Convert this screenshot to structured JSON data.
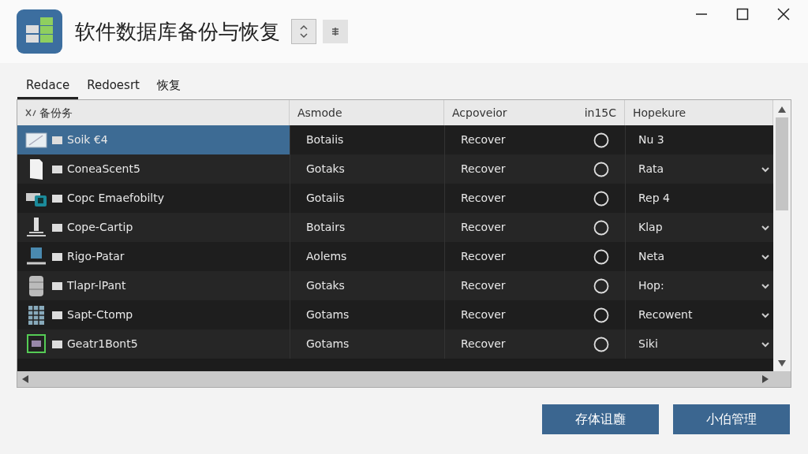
{
  "window": {
    "title": "软件数据库备份与恢复"
  },
  "tabs": [
    {
      "label": "Redace",
      "selected": true
    },
    {
      "label": "Redoesrt",
      "selected": false
    },
    {
      "label": "恢复",
      "selected": false
    }
  ],
  "table": {
    "columns": [
      {
        "label": "备份务"
      },
      {
        "label": "Asmode"
      },
      {
        "label": "Acpoveior",
        "extra": "in15C"
      },
      {
        "label": "Hopekure"
      }
    ],
    "rows": [
      {
        "kind": "image",
        "name": "Soik €4",
        "mode": "Botaiis",
        "action": "Recover",
        "value": "Nu 3",
        "dropdown": false,
        "selected": true
      },
      {
        "kind": "document",
        "name": "ConeaScent5",
        "mode": "Gotaks",
        "action": "Recover",
        "value": "Rata",
        "dropdown": true,
        "selected": false
      },
      {
        "kind": "drive",
        "name": "Copc Emaefobilty",
        "mode": "Gotaiis",
        "action": "Recover",
        "value": "Rep 4",
        "dropdown": false,
        "selected": false
      },
      {
        "kind": "network",
        "name": "Cope-Cartip",
        "mode": "Botairs",
        "action": "Recover",
        "value": "Klap",
        "dropdown": true,
        "selected": false
      },
      {
        "kind": "monitor",
        "name": "Rigo-Patar",
        "mode": "Aolems",
        "action": "Recover",
        "value": "Neta",
        "dropdown": true,
        "selected": false
      },
      {
        "kind": "database",
        "name": "Tlapr-lPant",
        "mode": "Gotaks",
        "action": "Recover",
        "value": "Hop:",
        "dropdown": true,
        "selected": false
      },
      {
        "kind": "grid",
        "name": "Sapt-Ctomp",
        "mode": "Gotams",
        "action": "Recover",
        "value": "Recowent",
        "dropdown": true,
        "selected": false
      },
      {
        "kind": "terminal",
        "name": "Geatr1Bont5",
        "mode": "Gotams",
        "action": "Recover",
        "value": "Siki",
        "dropdown": true,
        "selected": false
      }
    ]
  },
  "buttons": [
    "存体诅廱",
    "小伯管理"
  ]
}
